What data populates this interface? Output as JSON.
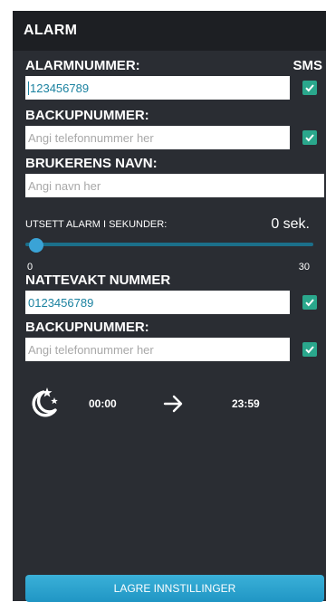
{
  "header": {
    "title": "ALARM"
  },
  "alarm": {
    "label": "ALARMNUMMER:",
    "sms_label": "SMS",
    "value": "123456789",
    "sms_checked": true
  },
  "backup1": {
    "label": "BACKUPNUMMER:",
    "placeholder": "Angi telefonnummer her",
    "sms_checked": true
  },
  "user": {
    "label": "BRUKERENS NAVN:",
    "placeholder": "Angi navn her"
  },
  "delay": {
    "label": "UTSETT ALARM I SEKUNDER:",
    "value_text": "0 sek.",
    "min": "0",
    "max": "30",
    "value": 0
  },
  "nightwatch": {
    "label": "NATTEVAKT NUMMER",
    "value": "0123456789",
    "sms_checked": true
  },
  "backup2": {
    "label": "BACKUPNUMMER:",
    "placeholder": "Angi telefonnummer her",
    "sms_checked": true
  },
  "night_schedule": {
    "icon": "moon-stars-icon",
    "start": "00:00",
    "arrow_icon": "arrow-right-icon",
    "end": "23:59"
  },
  "actions": {
    "save_label": "LAGRE INNSTILLINGER"
  },
  "colors": {
    "background": "#2a2d33",
    "titlebar": "#1d1f23",
    "accent": "#2aa78c",
    "slider": "#3aa3d6",
    "button": "#2ea4cf",
    "value_text": "#1b82a0"
  }
}
